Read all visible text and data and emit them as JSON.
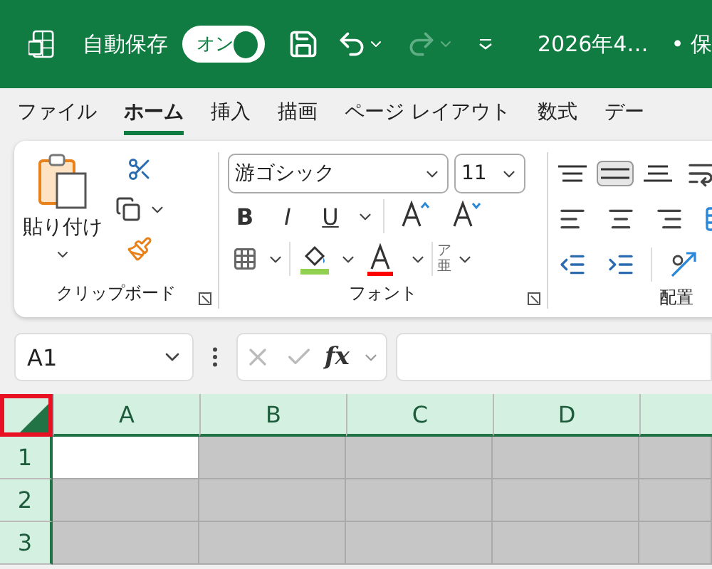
{
  "title_bar": {
    "autosave_label": "自動保存",
    "autosave": {
      "label": "オン",
      "on": true
    },
    "redo_enabled": false,
    "file_name": "2026年4…",
    "status": "• 保"
  },
  "tabs": [
    {
      "label": "ファイル",
      "selected": false
    },
    {
      "label": "ホーム",
      "selected": true
    },
    {
      "label": "挿入",
      "selected": false
    },
    {
      "label": "描画",
      "selected": false
    },
    {
      "label": "ページ レイアウト",
      "selected": false
    },
    {
      "label": "数式",
      "selected": false
    },
    {
      "label": "デー",
      "selected": false
    }
  ],
  "ribbon": {
    "clipboard": {
      "paste_label": "貼り付け",
      "group_label": "クリップボード"
    },
    "font": {
      "font_name": "游ゴシック",
      "font_size": "11",
      "style_buttons": [
        "B",
        "I",
        "U"
      ],
      "phonetic_top": "ア",
      "phonetic_bottom": "亜",
      "group_label": "フォント"
    },
    "alignment": {
      "group_label": "配置",
      "vertical": [
        {
          "kind": "top",
          "selected": false
        },
        {
          "kind": "middle",
          "selected": true
        },
        {
          "kind": "bottom",
          "selected": false
        }
      ]
    }
  },
  "formula_bar": {
    "name_box": "A1",
    "function_button": "fx"
  },
  "sheet": {
    "select_all_highlighted": true,
    "columns": [
      "A",
      "B",
      "C",
      "D"
    ],
    "rows": [
      {
        "label": "1",
        "cells": [
          {
            "selected": false
          },
          {
            "selected": true
          },
          {
            "selected": true
          },
          {
            "selected": true
          },
          {
            "selected": true
          }
        ]
      },
      {
        "label": "2",
        "cells": [
          {
            "selected": true
          },
          {
            "selected": true
          },
          {
            "selected": true
          },
          {
            "selected": true
          },
          {
            "selected": true
          }
        ]
      },
      {
        "label": "3",
        "cells": [
          {
            "selected": true
          },
          {
            "selected": true
          },
          {
            "selected": true
          },
          {
            "selected": true
          },
          {
            "selected": true
          }
        ]
      }
    ]
  }
}
